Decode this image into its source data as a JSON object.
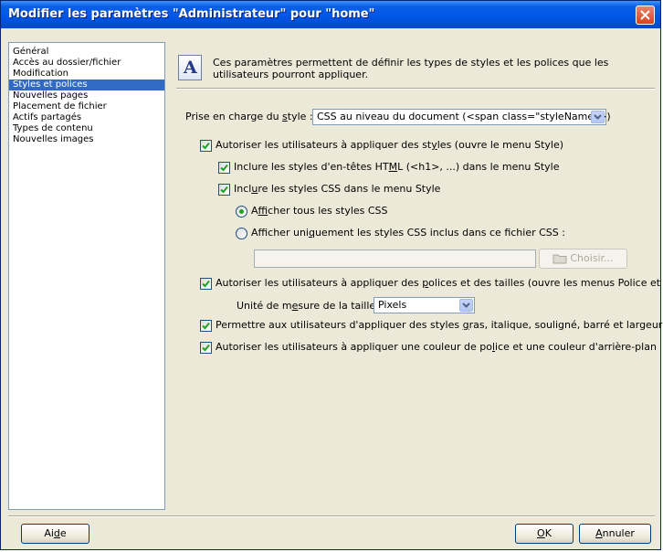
{
  "window": {
    "title": "Modifier les paramètres \"Administrateur\" pour \"home\""
  },
  "nav": {
    "items": [
      {
        "label": "Général",
        "selected": false
      },
      {
        "label": "Accès au dossier/fichier",
        "selected": false
      },
      {
        "label": "Modification",
        "selected": false
      },
      {
        "label": "Styles et polices",
        "selected": true
      },
      {
        "label": "Nouvelles pages",
        "selected": false
      },
      {
        "label": "Placement de fichier",
        "selected": false
      },
      {
        "label": "Actifs partagés",
        "selected": false
      },
      {
        "label": "Types de contenu",
        "selected": false
      },
      {
        "label": "Nouvelles images",
        "selected": false
      }
    ]
  },
  "info": {
    "icon": "font-a-icon",
    "text": "Ces paramètres permettent de définir les types de styles et les polices que les utilisateurs pourront appliquer."
  },
  "style_support": {
    "label_pre": "Prise en charge du ",
    "label_u": "s",
    "label_post": "tyle :",
    "value": "CSS au niveau du document (<span class=\"styleName\">)"
  },
  "allow_styles": {
    "pre": "Autoriser les utilisateurs à appliquer des st",
    "u": "y",
    "post": "les (ouvre le menu Style)",
    "checked": true
  },
  "include_headings": {
    "pre": "Inclure les styles d'en-têtes HT",
    "u": "M",
    "post": "L (<h1>, ...) dans le menu Style",
    "checked": true
  },
  "include_css": {
    "pre": "Incl",
    "u": "u",
    "post": "re les styles CSS dans le menu Style",
    "checked": true
  },
  "show_all_css": {
    "pre": "A",
    "u": "f",
    "post": "ficher tous les styles CSS",
    "checked": true
  },
  "show_only_css": {
    "pre": "Afficher  uni",
    "u": "q",
    "post": "uement les styles CSS inclus dans ce fichier CSS :",
    "checked": false
  },
  "css_file": {
    "value": "",
    "choose_label": "Choisir..."
  },
  "allow_fonts": {
    "pre": "Autoriser les utilisateurs à appliquer des ",
    "u": "p",
    "post": "olices et des tailles (ouvre les menus Police et Taille)",
    "checked": true
  },
  "size_unit": {
    "pre": "Unité de m",
    "u": "e",
    "post": "sure de la taille :",
    "value": "Pixels"
  },
  "allow_bold": {
    "pre": "Permettre aux utilisateurs d'appliquer des styles ",
    "u": "g",
    "post": "ras, italique, souligné, barré et largeur fixe",
    "checked": true
  },
  "allow_colors": {
    "pre": "Autoriser les utilisateurs à appliquer une couleur de po",
    "u": "l",
    "post": "ice et une couleur d'arrière-plan",
    "checked": true
  },
  "footer": {
    "help_pre": "Ai",
    "help_u": "d",
    "help_post": "e",
    "ok_u": "O",
    "ok_post": "K",
    "cancel_u": "A",
    "cancel_post": "nnuler"
  }
}
